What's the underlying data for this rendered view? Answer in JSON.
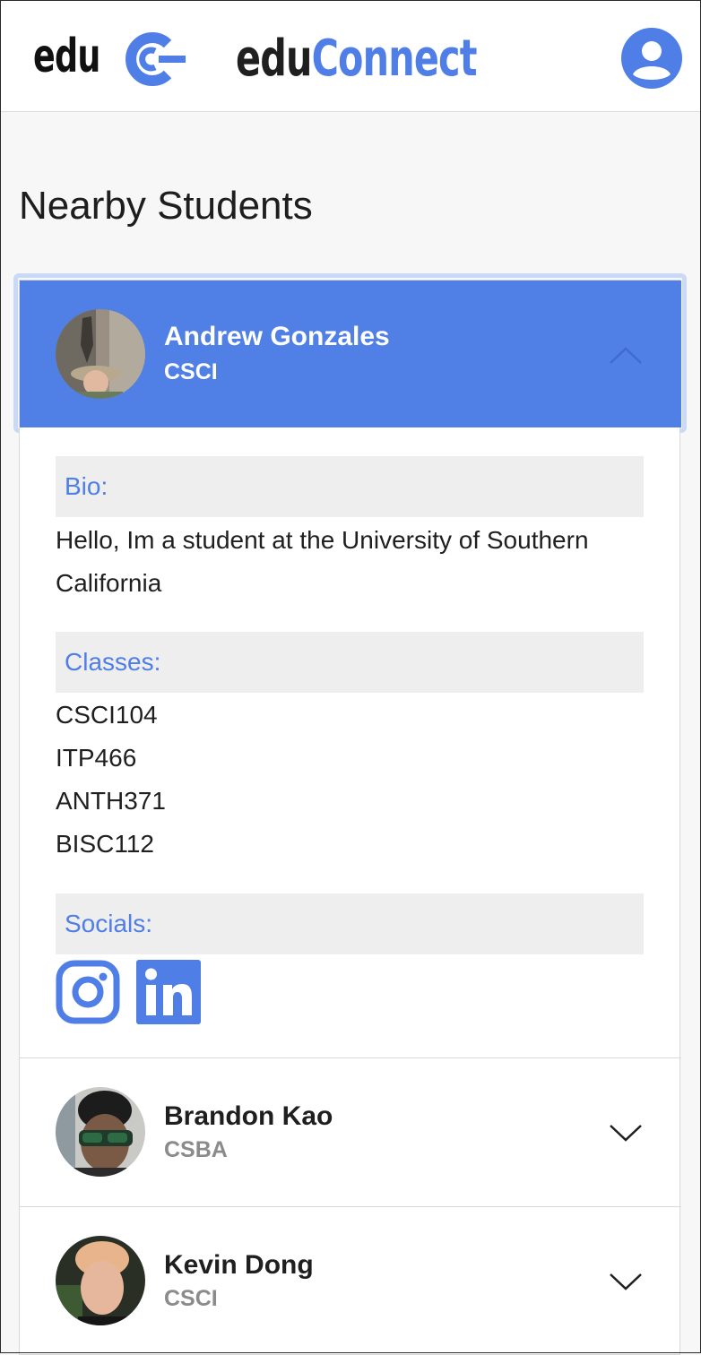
{
  "header": {
    "logo_text": "edu",
    "brand_part1": "edu",
    "brand_part2": "Connect"
  },
  "page": {
    "title": "Nearby Students"
  },
  "students": [
    {
      "name": "Andrew Gonzales",
      "major": "CSCI",
      "expanded": true,
      "bio_label": "Bio:",
      "bio": "Hello, Im a student at the University of Southern California",
      "classes_label": "Classes:",
      "classes": [
        "CSCI104",
        "ITP466",
        "ANTH371",
        "BISC112"
      ],
      "socials_label": "Socials:",
      "socials": [
        "instagram-icon",
        "linkedin-icon"
      ]
    },
    {
      "name": "Brandon Kao",
      "major": "CSBA",
      "expanded": false
    },
    {
      "name": "Kevin Dong",
      "major": "CSCI",
      "expanded": false
    }
  ],
  "colors": {
    "accent": "#4f7ee6",
    "active_header": "#5080e6",
    "section_bg": "#eeeeee",
    "muted": "#8b8b8b"
  }
}
